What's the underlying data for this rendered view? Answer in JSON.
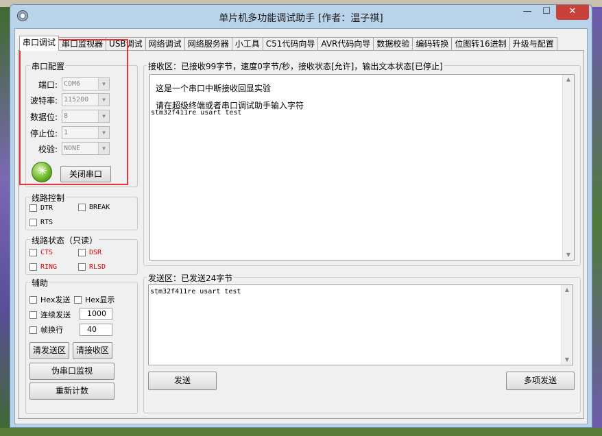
{
  "window": {
    "title": "单片机多功能调试助手 [作者：温子祺]",
    "min_glyph": "—",
    "max_glyph": "☐",
    "close_glyph": "✕"
  },
  "tabs": [
    {
      "label": "串口调试",
      "active": true
    },
    {
      "label": "串口监视器"
    },
    {
      "label": "USB调试"
    },
    {
      "label": "网络调试"
    },
    {
      "label": "网络服务器"
    },
    {
      "label": "小工具"
    },
    {
      "label": "C51代码向导"
    },
    {
      "label": "AVR代码向导"
    },
    {
      "label": "数据校验"
    },
    {
      "label": "编码转换"
    },
    {
      "label": "位图转16进制"
    },
    {
      "label": "升级与配置"
    }
  ],
  "serial_config": {
    "title": "串口配置",
    "port": {
      "label": "端口:",
      "value": "COM6"
    },
    "baud": {
      "label": "波特率:",
      "value": "115200"
    },
    "data_bits": {
      "label": "数据位:",
      "value": "8"
    },
    "stop_bits": {
      "label": "停止位:",
      "value": "1"
    },
    "parity": {
      "label": "校验:",
      "value": "NONE"
    },
    "close_button": "关闭串口",
    "power_icon": "power-status-icon"
  },
  "line_control": {
    "title": "线路控制",
    "dtr": "DTR",
    "break": "BREAK",
    "rts": "RTS"
  },
  "line_status": {
    "title": "线路状态（只读）",
    "cts": "CTS",
    "dsr": "DSR",
    "ring": "RING",
    "rlsd": "RLSD",
    "status_color": "#d40000"
  },
  "assist": {
    "title": "辅助",
    "hex_send": "Hex发送",
    "hex_display": "Hex显示",
    "continuous_send": "连续发送",
    "continuous_interval": "1000",
    "frame_newline": "帧换行",
    "frame_value": "40",
    "clear_send": "清发送区",
    "clear_receive": "清接收区",
    "pseudo_monitor": "伪串口监视",
    "reset_count": "重新计数"
  },
  "receive": {
    "title": "接收区：已接收99字节，速度0字节/秒，接收状态[允许]，输出文本状态[已停止]",
    "lines": [
      "这是一个串口中断接收回显实验",
      "请在超级终端或者串口调试助手输入字符",
      "stm32f411re usart test"
    ]
  },
  "send": {
    "title": "发送区：已发送24字节",
    "text": "stm32f411re usart test",
    "send_button": "发送",
    "multi_send_button": "多项发送"
  },
  "colors": {
    "highlight_frame": "#e8333a",
    "close_button": "#c7413a",
    "window_frame": "#b9d3ea"
  }
}
